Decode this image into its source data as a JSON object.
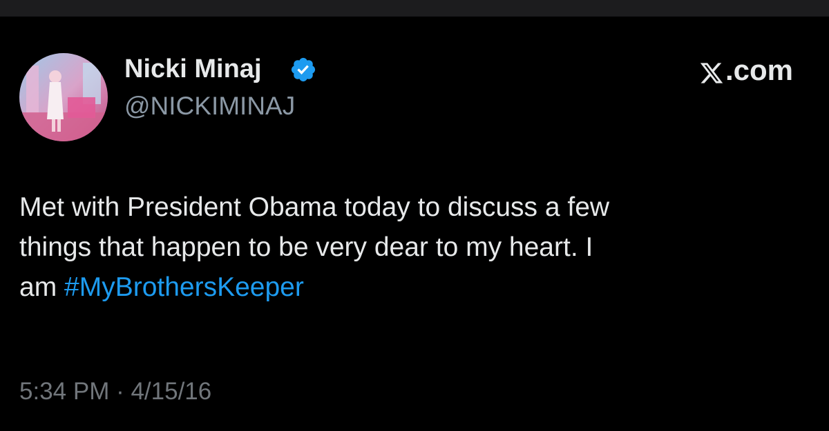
{
  "tweet": {
    "author": {
      "display_name": "Nicki Minaj",
      "handle": "@NICKIMINAJ",
      "verified_icon": "verified-badge-icon",
      "avatar_icon": "avatar-photo"
    },
    "site_label": ".com",
    "site_logo_icon": "x-logo-icon",
    "text_lines": [
      "Met with President Obama today to discuss a few",
      "things that happen to be very dear to my heart. I"
    ],
    "text_last_prefix": "am ",
    "hashtag": "#MyBrothersKeeper",
    "timestamp": "5:34 PM · 4/15/16"
  },
  "colors": {
    "background": "#000000",
    "text": "#e7e9ea",
    "secondary": "#8b98a5",
    "link": "#1d9bf0",
    "verified": "#1d9bf0"
  }
}
